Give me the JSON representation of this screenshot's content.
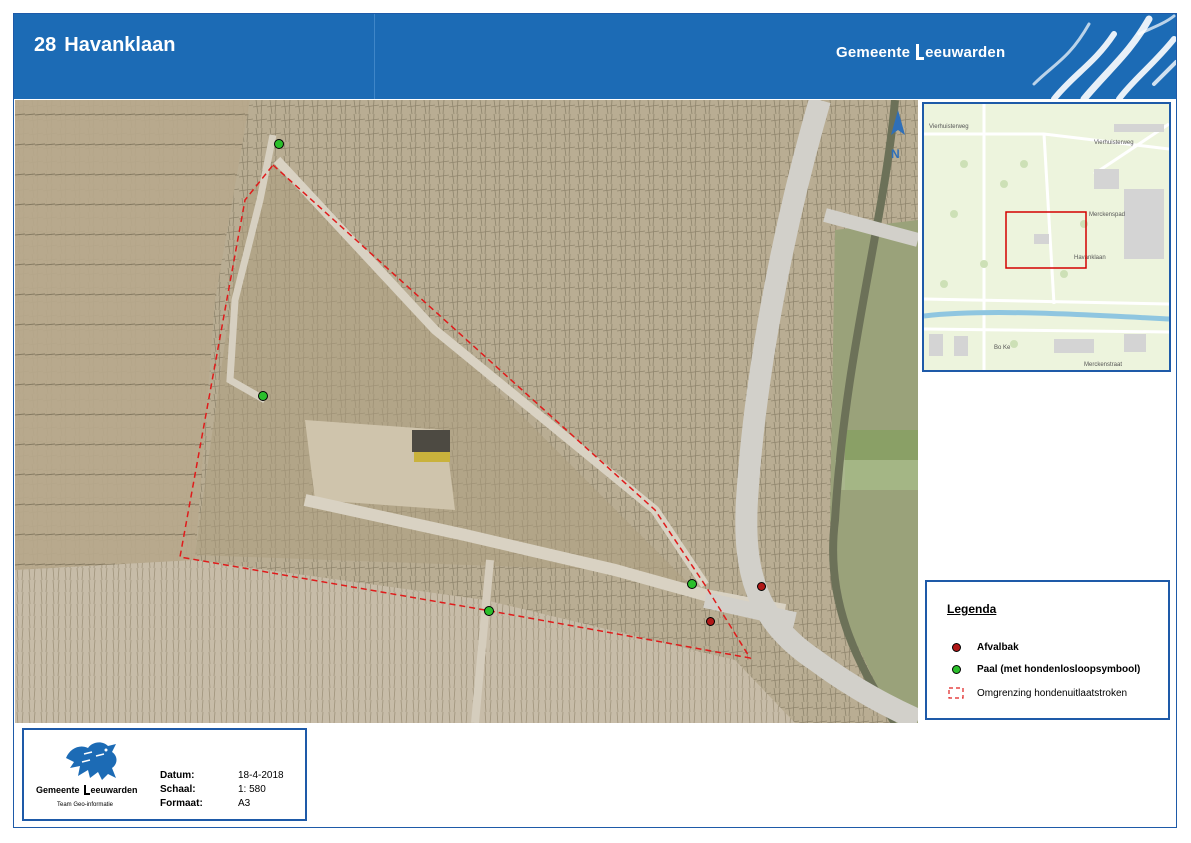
{
  "header": {
    "number": "28",
    "title": "Havanklaan",
    "brand_prefix": "Gemeente",
    "brand_name": "eeuwarden"
  },
  "map": {
    "north_label": "N"
  },
  "overview_map": {
    "street_labels": [
      "Vierhuisterweg",
      "Vierhuisterweg",
      "Merckenspad",
      "Havanklaan",
      "Merckenstraat",
      "Bo Ke"
    ]
  },
  "legend": {
    "title": "Legenda",
    "items": [
      {
        "label": "Afvalbak",
        "color": "#b01818"
      },
      {
        "label": "Paal (met hondenlosloopsymbool)",
        "color": "#2bbf2b"
      },
      {
        "label": "Omgrenzing hondenuitlaatstroken",
        "color": "#e02020"
      }
    ]
  },
  "info": {
    "org_prefix": "Gemeente",
    "org_name": "eeuwarden",
    "team": "Team Geo-informatie",
    "datum_label": "Datum:",
    "datum_value": "18-4-2018",
    "schaal_label": "Schaal:",
    "schaal_value": "1: 580",
    "formaat_label": "Formaat:",
    "formaat_value": "A3"
  }
}
